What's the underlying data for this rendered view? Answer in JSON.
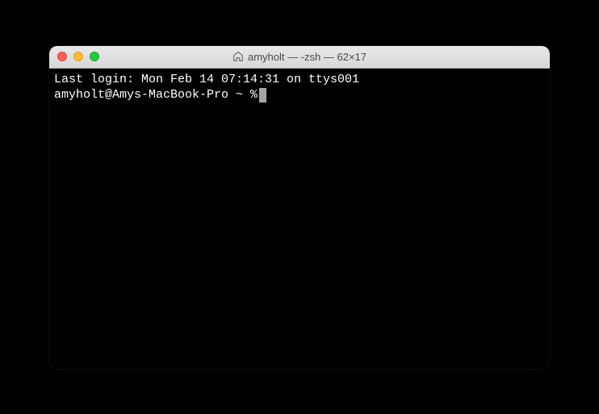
{
  "window": {
    "title": "amyholt — -zsh — 62×17"
  },
  "terminal": {
    "last_login_line": "Last login: Mon Feb 14 07:14:31 on ttys001",
    "prompt": "amyholt@Amys-MacBook-Pro ~ % "
  }
}
